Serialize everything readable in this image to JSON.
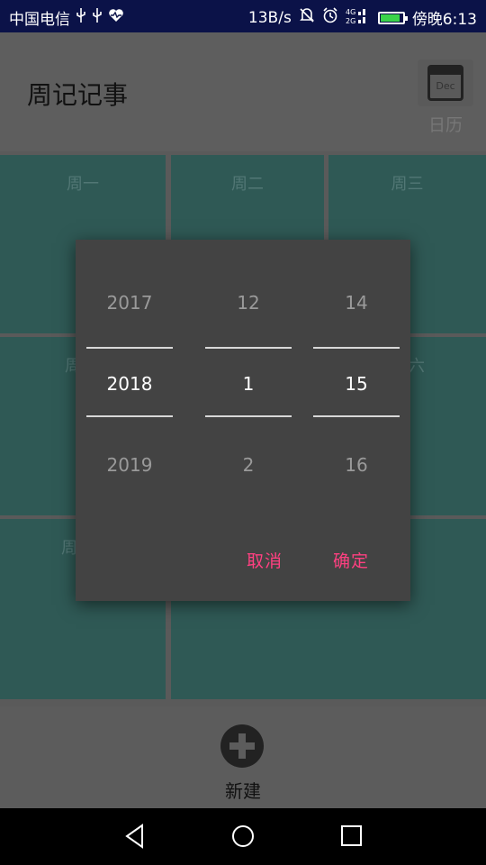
{
  "status_bar": {
    "carrier": "中国电信",
    "speed": "13B/s",
    "time": "傍晚6:13",
    "icons": [
      "usb-icon",
      "usb-icon",
      "health-icon",
      "mute-icon",
      "alarm-icon",
      "signal-4g-icon",
      "battery-icon"
    ],
    "battery_level": 0.9,
    "battery_color": "#3bd34a"
  },
  "header": {
    "title": "周记记事",
    "calendar_icon_text": "Dec",
    "calendar_label": "日历"
  },
  "week_cells": [
    "周一",
    "周二",
    "周三",
    "周",
    "六",
    "周"
  ],
  "bottom": {
    "new_label": "新建"
  },
  "date_picker": {
    "year": {
      "prev": "2017",
      "selected": "2018",
      "next": "2019"
    },
    "month": {
      "prev": "12",
      "selected": "1",
      "next": "2"
    },
    "day": {
      "prev": "14",
      "selected": "15",
      "next": "16"
    },
    "cancel_label": "取消",
    "confirm_label": "确定",
    "accent_color": "#ff4081"
  },
  "nav_bar": {
    "buttons": [
      "back-icon",
      "home-icon",
      "recents-icon"
    ]
  }
}
